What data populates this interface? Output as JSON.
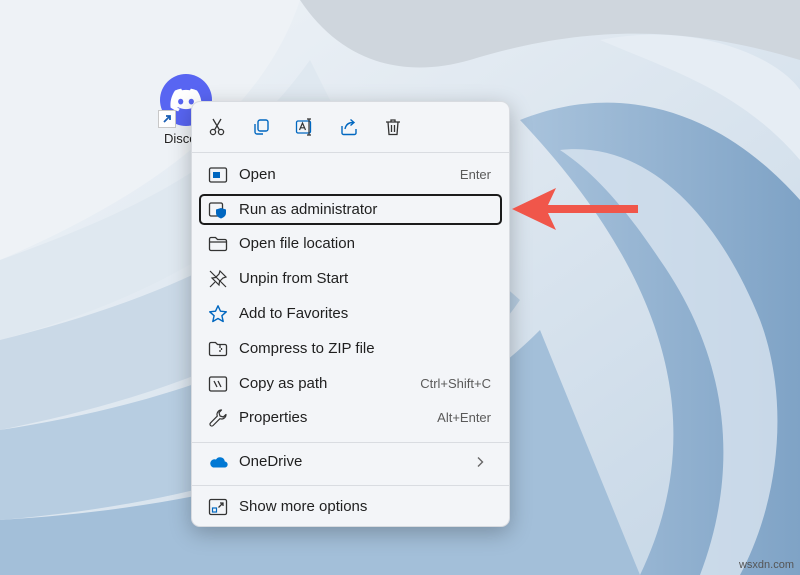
{
  "desktop": {
    "icon_label": "Disco",
    "watermark": "wsxdn.com"
  },
  "context_menu": {
    "toolbar": [
      {
        "name": "cut-icon"
      },
      {
        "name": "copy-icon"
      },
      {
        "name": "rename-icon"
      },
      {
        "name": "share-icon"
      },
      {
        "name": "delete-icon"
      }
    ],
    "items": [
      {
        "label": "Open",
        "shortcut": "Enter",
        "icon": "open-app-icon"
      },
      {
        "label": "Run as administrator",
        "shortcut": "",
        "icon": "uac-shield-icon"
      },
      {
        "label": "Open file location",
        "shortcut": "",
        "icon": "folder-icon"
      },
      {
        "label": "Unpin from Start",
        "shortcut": "",
        "icon": "unpin-icon"
      },
      {
        "label": "Add to Favorites",
        "shortcut": "",
        "icon": "star-icon"
      },
      {
        "label": "Compress to ZIP file",
        "shortcut": "",
        "icon": "zip-folder-icon"
      },
      {
        "label": "Copy as path",
        "shortcut": "Ctrl+Shift+C",
        "icon": "copy-path-icon"
      },
      {
        "label": "Properties",
        "shortcut": "Alt+Enter",
        "icon": "wrench-icon"
      },
      {
        "label": "OneDrive",
        "shortcut": "",
        "icon": "onedrive-cloud-icon"
      },
      {
        "label": "Show more options",
        "shortcut": "",
        "icon": "more-options-icon"
      }
    ]
  },
  "colors": {
    "accent": "#0067C0",
    "discord": "#5865F2",
    "arrow": "#F0564A"
  }
}
